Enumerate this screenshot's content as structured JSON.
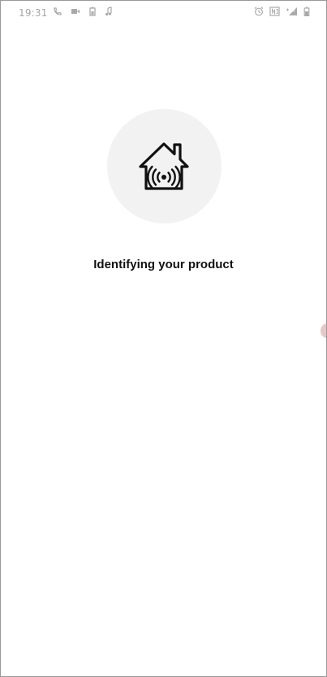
{
  "status_bar": {
    "time": "19:31",
    "left_icons": [
      "wifi-calling-icon",
      "video-icon",
      "battery-saver-icon",
      "music-note-icon"
    ],
    "right_icons": [
      "alarm-icon",
      "nfc-icon",
      "signal-icon",
      "battery-icon"
    ]
  },
  "main": {
    "hero_icon": "smart-home-icon",
    "title": "Identifying your product"
  }
}
